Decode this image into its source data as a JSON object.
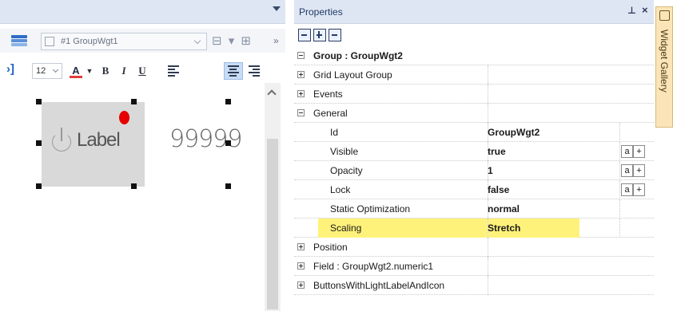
{
  "designer": {
    "toolbar1": {
      "layer_icon": "layers-icon",
      "widget_combo_value": "#1 GroupWgt1",
      "align_icons": "⊟ ▾ ⊞",
      "more": "»"
    },
    "toolbar2": {
      "indent_icon": "›]",
      "font_size": "12",
      "font_color_glyph": "A",
      "font_color_dropdown": "▼",
      "bold": "B",
      "italic": "I",
      "underline": "U"
    },
    "canvas": {
      "button_widget_label": "Label",
      "numeric_widget_value": "99999"
    }
  },
  "properties": {
    "title": "Properties",
    "pin": "⊥",
    "close": "×",
    "rows": [
      {
        "kind": "header",
        "name": "Group : GroupWgt2"
      },
      {
        "kind": "category",
        "name": "Grid Layout Group",
        "expanded": false
      },
      {
        "kind": "category",
        "name": "Events",
        "expanded": false
      },
      {
        "kind": "category",
        "name": "General",
        "expanded": true
      },
      {
        "kind": "property",
        "name": "Id",
        "value": "GroupWgt2",
        "buttons": false
      },
      {
        "kind": "property",
        "name": "Visible",
        "value": "true",
        "buttons": true
      },
      {
        "kind": "property",
        "name": "Opacity",
        "value": "1",
        "buttons": true
      },
      {
        "kind": "property",
        "name": "Lock",
        "value": "false",
        "buttons": true
      },
      {
        "kind": "property",
        "name": "Static Optimization",
        "value": "normal",
        "buttons": false
      },
      {
        "kind": "property",
        "name": "Scaling",
        "value": "Stretch",
        "buttons": false,
        "highlight": true
      },
      {
        "kind": "category",
        "name": "Position",
        "expanded": false
      },
      {
        "kind": "category",
        "name": "Field : GroupWgt2.numeric1",
        "expanded": false
      },
      {
        "kind": "category",
        "name": "ButtonsWithLightLabelAndIcon",
        "expanded": false
      }
    ],
    "btn_a": "a",
    "btn_plus": "+"
  },
  "gallery": {
    "label": "Widget Gallery",
    "icon": "gallery-icon"
  },
  "colors": {
    "titlebar": "#dfe6f3",
    "highlight": "#fff27a",
    "gallery_tab": "#fbe5b8",
    "status_dot": "#e60000"
  }
}
